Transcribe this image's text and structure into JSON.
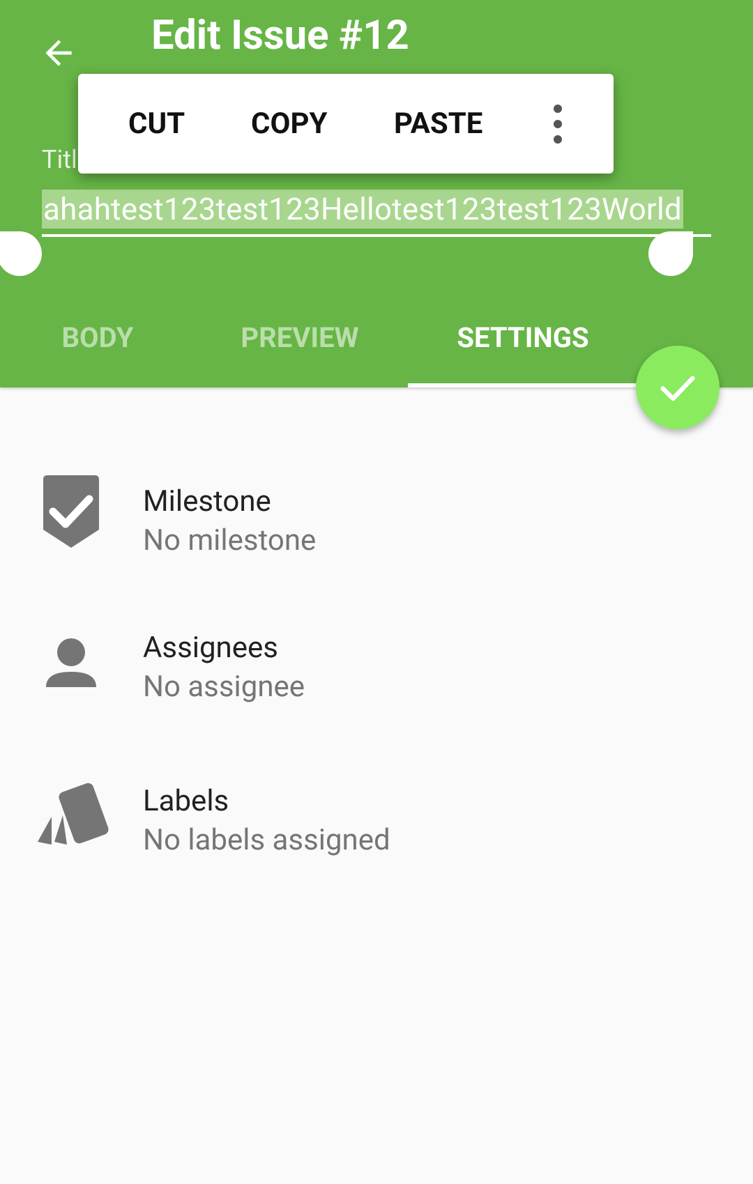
{
  "header": {
    "title": "Edit Issue #12",
    "subtitle": "",
    "title_field_label": "Titl",
    "title_field_value": "ahahtest123test123Hellotest123test123World"
  },
  "context_menu": {
    "cut": "CUT",
    "copy": "COPY",
    "paste": "PASTE"
  },
  "tabs": [
    {
      "label": "BODY",
      "selected": false
    },
    {
      "label": "PREVIEW",
      "selected": false
    },
    {
      "label": "SETTINGS",
      "selected": true
    }
  ],
  "settings": {
    "milestone": {
      "label": "Milestone",
      "value": "No milestone",
      "icon": "milestone-icon"
    },
    "assignees": {
      "label": "Assignees",
      "value": "No assignee",
      "icon": "person-icon"
    },
    "labels": {
      "label": "Labels",
      "value": "No labels assigned",
      "icon": "label-tags-icon"
    }
  },
  "colors": {
    "appbar": "#66b546",
    "fab": "#8aeb5f",
    "selection": "#a8d68e",
    "icon_gray": "#757575"
  }
}
